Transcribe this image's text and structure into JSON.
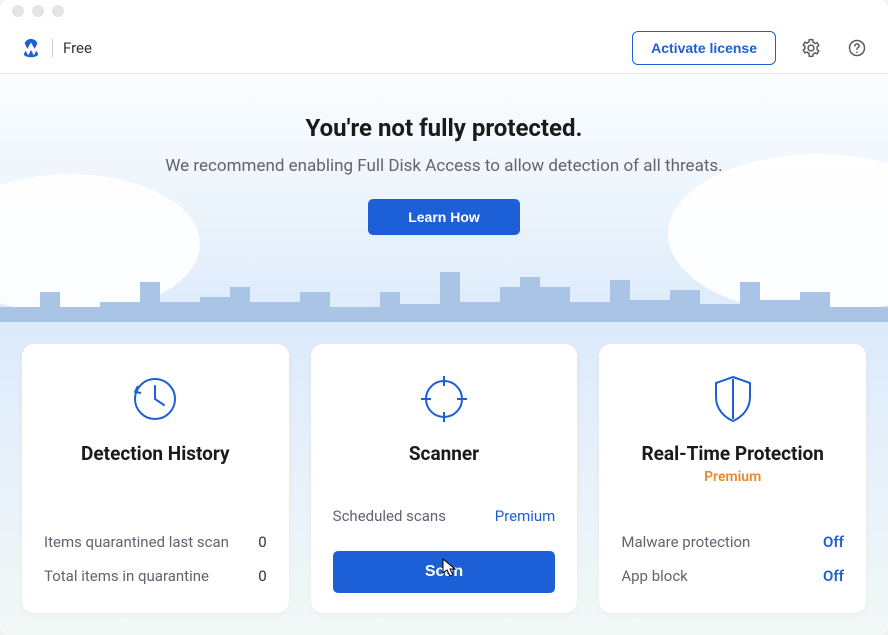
{
  "toolbar": {
    "plan": "Free",
    "activate_label": "Activate license"
  },
  "hero": {
    "title": "You're not fully protected.",
    "subtitle": "We recommend enabling Full Disk Access to allow detection of all threats.",
    "button": "Learn How"
  },
  "cards": {
    "detection": {
      "title": "Detection History",
      "rows": [
        {
          "label": "Items quarantined last scan",
          "value": "0"
        },
        {
          "label": "Total items in quarantine",
          "value": "0"
        }
      ]
    },
    "scanner": {
      "title": "Scanner",
      "row": {
        "label": "Scheduled scans",
        "value": "Premium"
      },
      "scan_button": "Scan"
    },
    "rtp": {
      "title": "Real-Time Protection",
      "subtitle": "Premium",
      "rows": [
        {
          "label": "Malware protection",
          "value": "Off"
        },
        {
          "label": "App block",
          "value": "Off"
        }
      ]
    }
  }
}
